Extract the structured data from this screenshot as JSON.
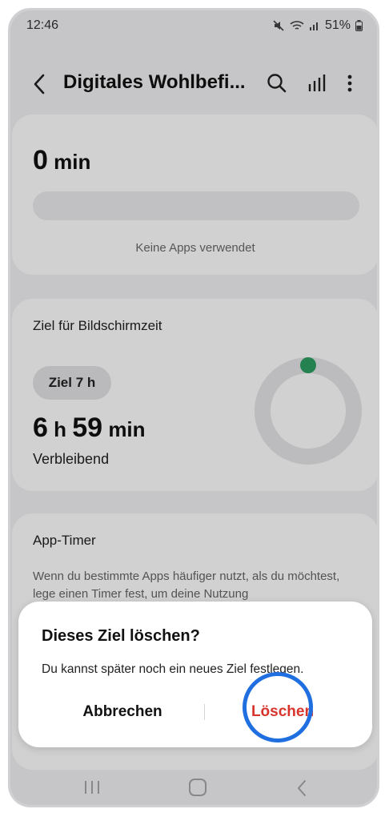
{
  "status": {
    "time": "12:46",
    "battery": "51%"
  },
  "appbar": {
    "title": "Digitales Wohlbefi...",
    "icons": [
      "back-icon",
      "search-icon",
      "stats-icon",
      "more-icon"
    ]
  },
  "usage_card": {
    "value": "0",
    "unit": " min",
    "empty_text": "Keine Apps verwendet"
  },
  "goal_card": {
    "title": "Ziel für Bildschirmzeit",
    "chip": "Ziel 7 h",
    "remaining_h": "6",
    "h_unit": " h ",
    "remaining_min": "59",
    "min_unit": " min",
    "remaining_label": "Verbleibend",
    "ring_color": "#2f9e62",
    "progress_fraction": 0.0
  },
  "timer_card": {
    "title": "App-Timer",
    "description": "Wenn du bestimmte Apps häufiger nutzt, als du möchtest, lege einen Timer fest, um deine Nutzung"
  },
  "dialog": {
    "title": "Dieses Ziel löschen?",
    "message": "Du kannst später noch ein neues Ziel festlegen.",
    "cancel_label": "Abbrechen",
    "delete_label": "Löschen",
    "delete_color": "#d7352c",
    "highlight_color": "#1f6fe0"
  },
  "navbar": {
    "icons": [
      "recent-apps-icon",
      "home-icon",
      "back-icon"
    ]
  }
}
